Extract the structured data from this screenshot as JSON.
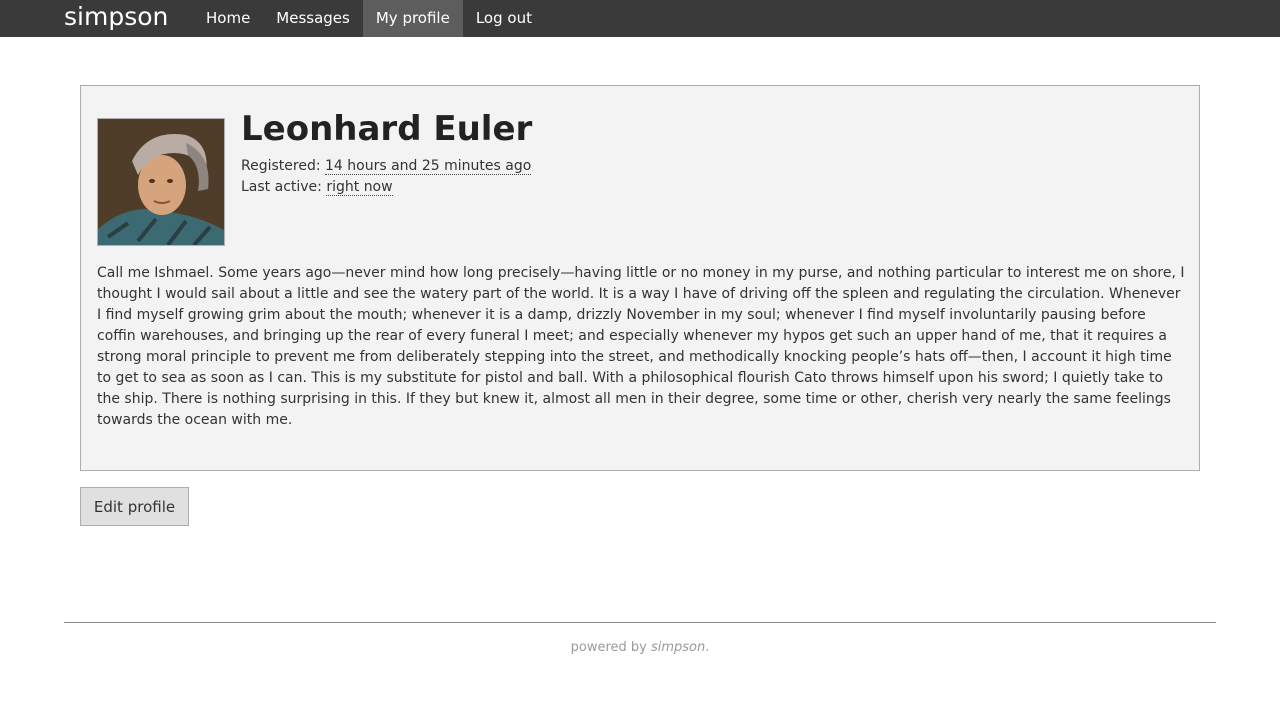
{
  "navbar": {
    "brand": "simpson",
    "items": [
      {
        "label": "Home"
      },
      {
        "label": "Messages"
      },
      {
        "label": "My profile",
        "active": true
      },
      {
        "label": "Log out"
      }
    ]
  },
  "profile": {
    "name": "Leonhard Euler",
    "registered_label": "Registered:",
    "registered_value": "14 hours and 25 minutes ago",
    "last_active_label": "Last active:",
    "last_active_value": "right now",
    "bio": "Call me Ishmael. Some years ago—never mind how long precisely—having little or no money in my purse, and nothing particular to interest me on shore, I thought I would sail about a little and see the watery part of the world. It is a way I have of driving off the spleen and regulating the circulation. Whenever I find myself growing grim about the mouth; whenever it is a damp, drizzly November in my soul; whenever I find myself involuntarily pausing before coffin warehouses, and bringing up the rear of every funeral I meet; and especially whenever my hypos get such an upper hand of me, that it requires a strong moral principle to prevent me from deliberately stepping into the street, and methodically knocking people’s hats off—then, I account it high time to get to sea as soon as I can. This is my substitute for pistol and ball. With a philosophical flourish Cato throws himself upon his sword; I quietly take to the ship. There is nothing surprising in this. If they but knew it, almost all men in their degree, some time or other, cherish very nearly the same feelings towards the ocean with me."
  },
  "actions": {
    "edit_label": "Edit profile"
  },
  "footer": {
    "prefix": "powered by ",
    "brand": "simpson",
    "suffix": "."
  },
  "colors": {
    "navbar_bg": "#3a3a3a",
    "nav_active_bg": "#5d5d5d",
    "card_bg": "#f3f3f3",
    "button_bg": "#e0e0e0"
  }
}
